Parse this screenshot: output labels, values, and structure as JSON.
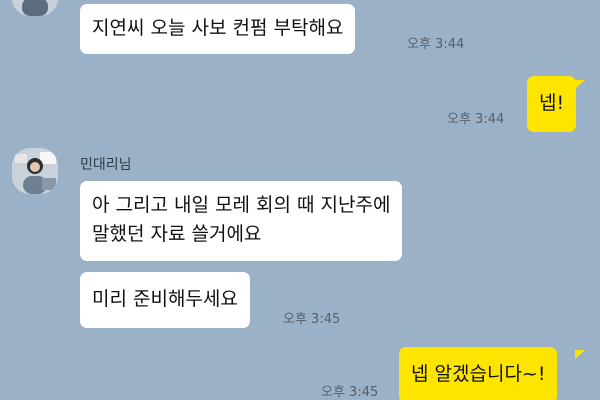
{
  "chat": {
    "sender_name": "민대리님",
    "messages": [
      {
        "direction": "in",
        "text": "지연씨 오늘 사보 컨펌 부탁해요",
        "time": "오후 3:44"
      },
      {
        "direction": "out",
        "text": "넵!",
        "time": "오후 3:44"
      },
      {
        "direction": "in",
        "text": "아 그리고 내일 모레 회의 때 지난주에\n말했던 자료 쓸거에요",
        "time": ""
      },
      {
        "direction": "in",
        "text": "미리 준비해두세요",
        "time": "오후 3:45"
      },
      {
        "direction": "out",
        "text": "넵 알겠습니다~!",
        "time": "오후 3:45"
      }
    ]
  },
  "colors": {
    "background": "#9bb1c8",
    "incoming_bubble": "#ffffff",
    "outgoing_bubble": "#fee500"
  }
}
